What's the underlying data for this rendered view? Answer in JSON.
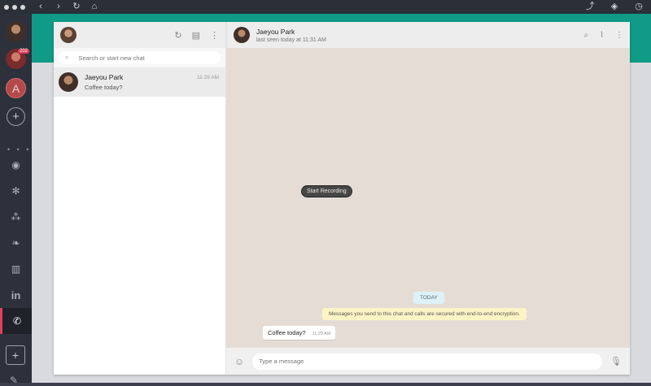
{
  "browser": {
    "back_icon": "‹",
    "forward_icon": "›",
    "reload_icon": "↻",
    "home_icon": "⌂",
    "share_icon": "⤴",
    "layers_icon": "◈",
    "clock_icon": "◷"
  },
  "rail": {
    "badge": "202",
    "letter_account": "A",
    "add_icon": "+",
    "more": "• • •",
    "services": {
      "messenger": "◉",
      "slack": "✻",
      "teams": "⁂",
      "evernote": "❧",
      "trello": "▥",
      "linkedin": "in",
      "whatsapp": "✆"
    },
    "add_service": "+",
    "settings_icon": "✎"
  },
  "sidebar": {
    "header_icons": {
      "refresh": "↻",
      "new_chat": "▤",
      "menu": "⋮"
    },
    "search_icon": "⌕",
    "search_placeholder": "Search or start new chat",
    "chats": [
      {
        "name": "Jaeyou Park",
        "last": "Coffee today?",
        "time": "11:29 AM"
      }
    ]
  },
  "conversation": {
    "contact_name": "Jaeyou Park",
    "contact_status": "last seen today at 11:31 AM",
    "header_icons": {
      "search": "⌕",
      "attach": "⌇",
      "menu": "⋮"
    },
    "recording_button": "Start Recording",
    "date_divider": "TODAY",
    "encryption_notice": "Messages you send to this chat and calls are secured with end-to-end encryption.",
    "messages": [
      {
        "text": "Coffee today?",
        "time": "11:29 AM"
      }
    ]
  },
  "composer": {
    "emoji_icon": "☺",
    "placeholder": "Type a message",
    "mic_icon": "🎙"
  }
}
